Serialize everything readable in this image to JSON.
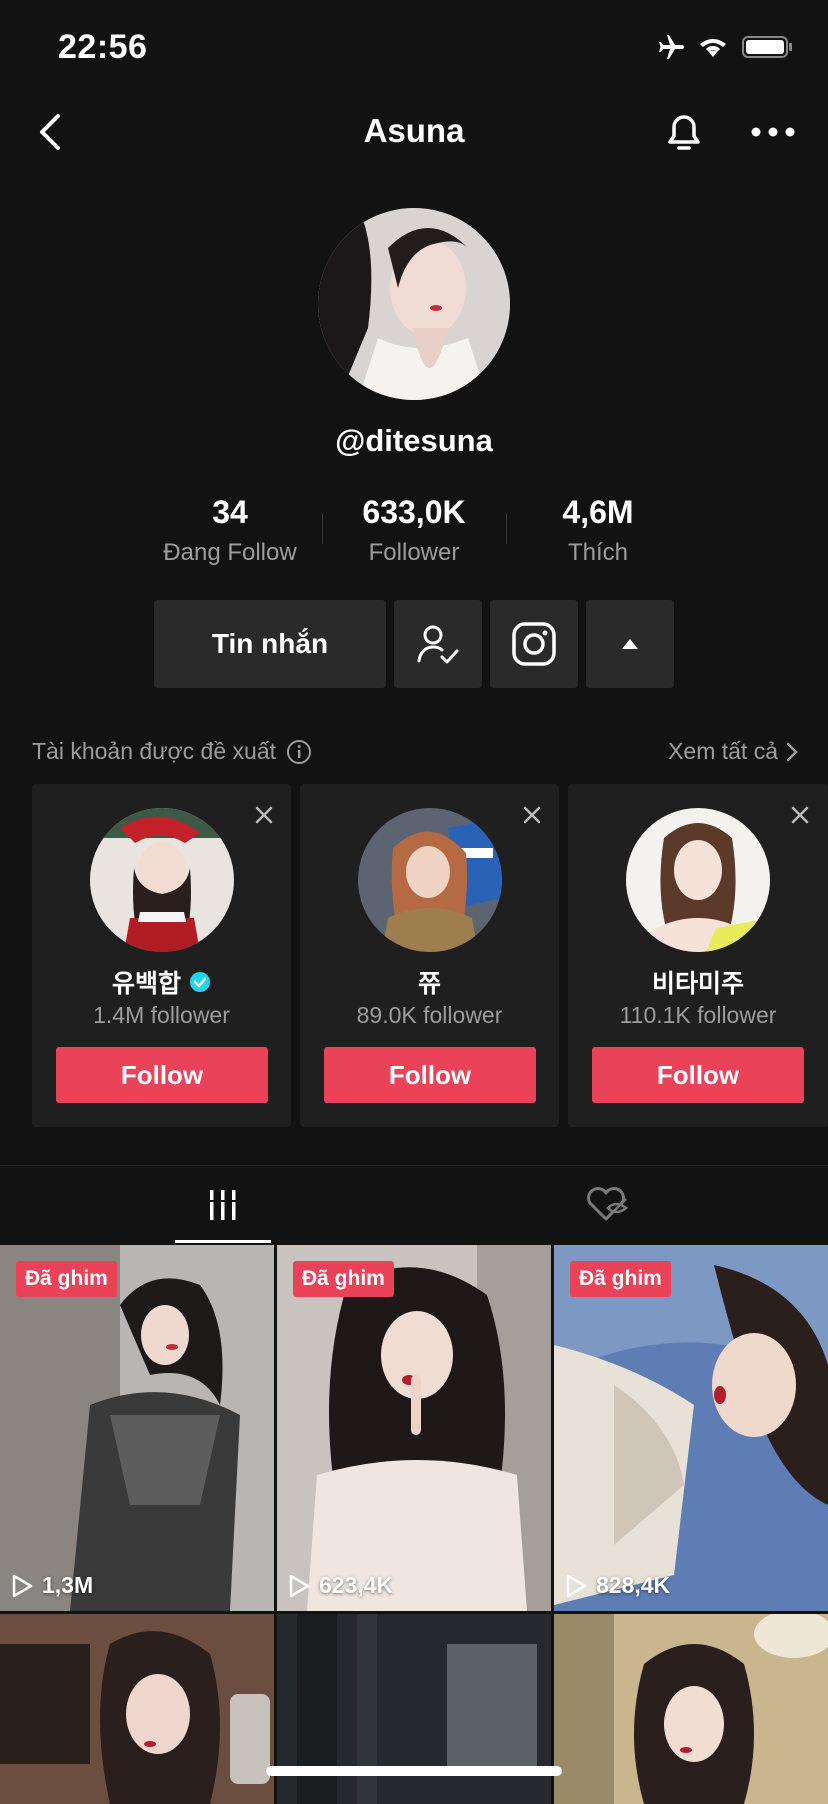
{
  "status_bar": {
    "time": "22:56"
  },
  "header": {
    "title": "Asuna"
  },
  "profile": {
    "handle": "@ditesuna",
    "stats": [
      {
        "value": "34",
        "label": "Đang Follow"
      },
      {
        "value": "633,0K",
        "label": "Follower"
      },
      {
        "value": "4,6M",
        "label": "Thích"
      }
    ],
    "message_label": "Tin nhắn"
  },
  "suggested": {
    "title": "Tài khoản được đề xuất",
    "see_all": "Xem tất cả",
    "accounts": [
      {
        "name": "유백합",
        "followers": "1.4M follower",
        "follow_label": "Follow",
        "verified": true
      },
      {
        "name": "쮸",
        "followers": "89.0K follower",
        "follow_label": "Follow",
        "verified": false
      },
      {
        "name": "비타미주",
        "followers": "110.1K follower",
        "follow_label": "Follow",
        "verified": false
      }
    ]
  },
  "videos": [
    {
      "pinned_label": "Đã ghim",
      "views": "1,3M"
    },
    {
      "pinned_label": "Đã ghim",
      "views": "623,4K"
    },
    {
      "pinned_label": "Đã ghim",
      "views": "828,4K"
    }
  ],
  "colors": {
    "accent": "#ea4359",
    "background": "#121212",
    "button": "#2a2a2a",
    "verified": "#20d5ec"
  }
}
